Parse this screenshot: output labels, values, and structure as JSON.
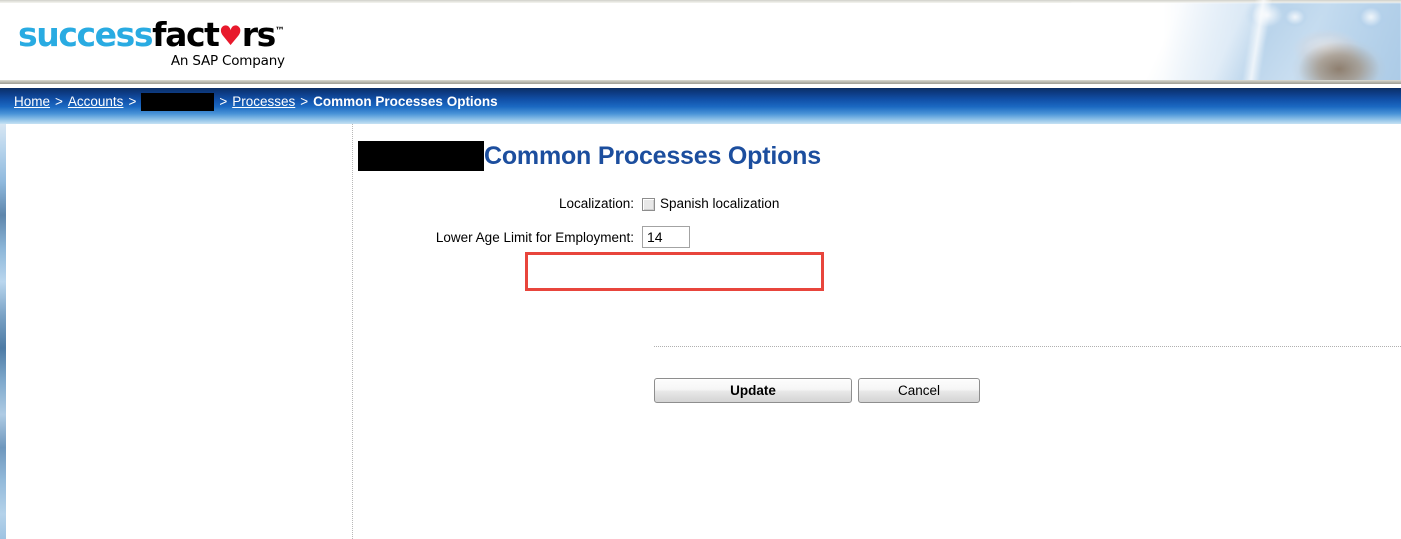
{
  "brand": {
    "logo_success": "success",
    "logo_fact": "fact",
    "logo_heart": "♥",
    "logo_rs": "rs",
    "logo_tm": "™",
    "tagline": "An SAP Company",
    "color_success": "#29abe2",
    "color_heart": "#e8192c"
  },
  "breadcrumb": {
    "items": [
      {
        "label": "Home",
        "type": "link"
      },
      {
        "label": ">",
        "type": "separator"
      },
      {
        "label": "Accounts",
        "type": "link"
      },
      {
        "label": ">",
        "type": "separator"
      },
      {
        "label": "",
        "type": "redacted"
      },
      {
        "label": ">",
        "type": "separator"
      },
      {
        "label": "Processes",
        "type": "link"
      },
      {
        "label": ">",
        "type": "separator"
      },
      {
        "label": "Common Processes Options",
        "type": "current"
      }
    ],
    "home_label": "Home",
    "accounts_label": "Accounts",
    "processes_label": "Processes",
    "current_label": "Common Processes Options",
    "separator": ">",
    "bar_color_top": "#0b2f66",
    "bar_color_bottom": "#c6e2f4"
  },
  "page": {
    "title": "Common Processes Options",
    "title_color": "#1c4e9e"
  },
  "form": {
    "localization": {
      "label": "Localization:",
      "checkbox_label": "Spanish localization",
      "checked": false
    },
    "lower_age_limit": {
      "label": "Lower Age Limit for Employment:",
      "value": "14"
    }
  },
  "highlight": {
    "color": "#e8453c",
    "target": "localization-row"
  },
  "actions": {
    "update_label": "Update",
    "cancel_label": "Cancel"
  }
}
